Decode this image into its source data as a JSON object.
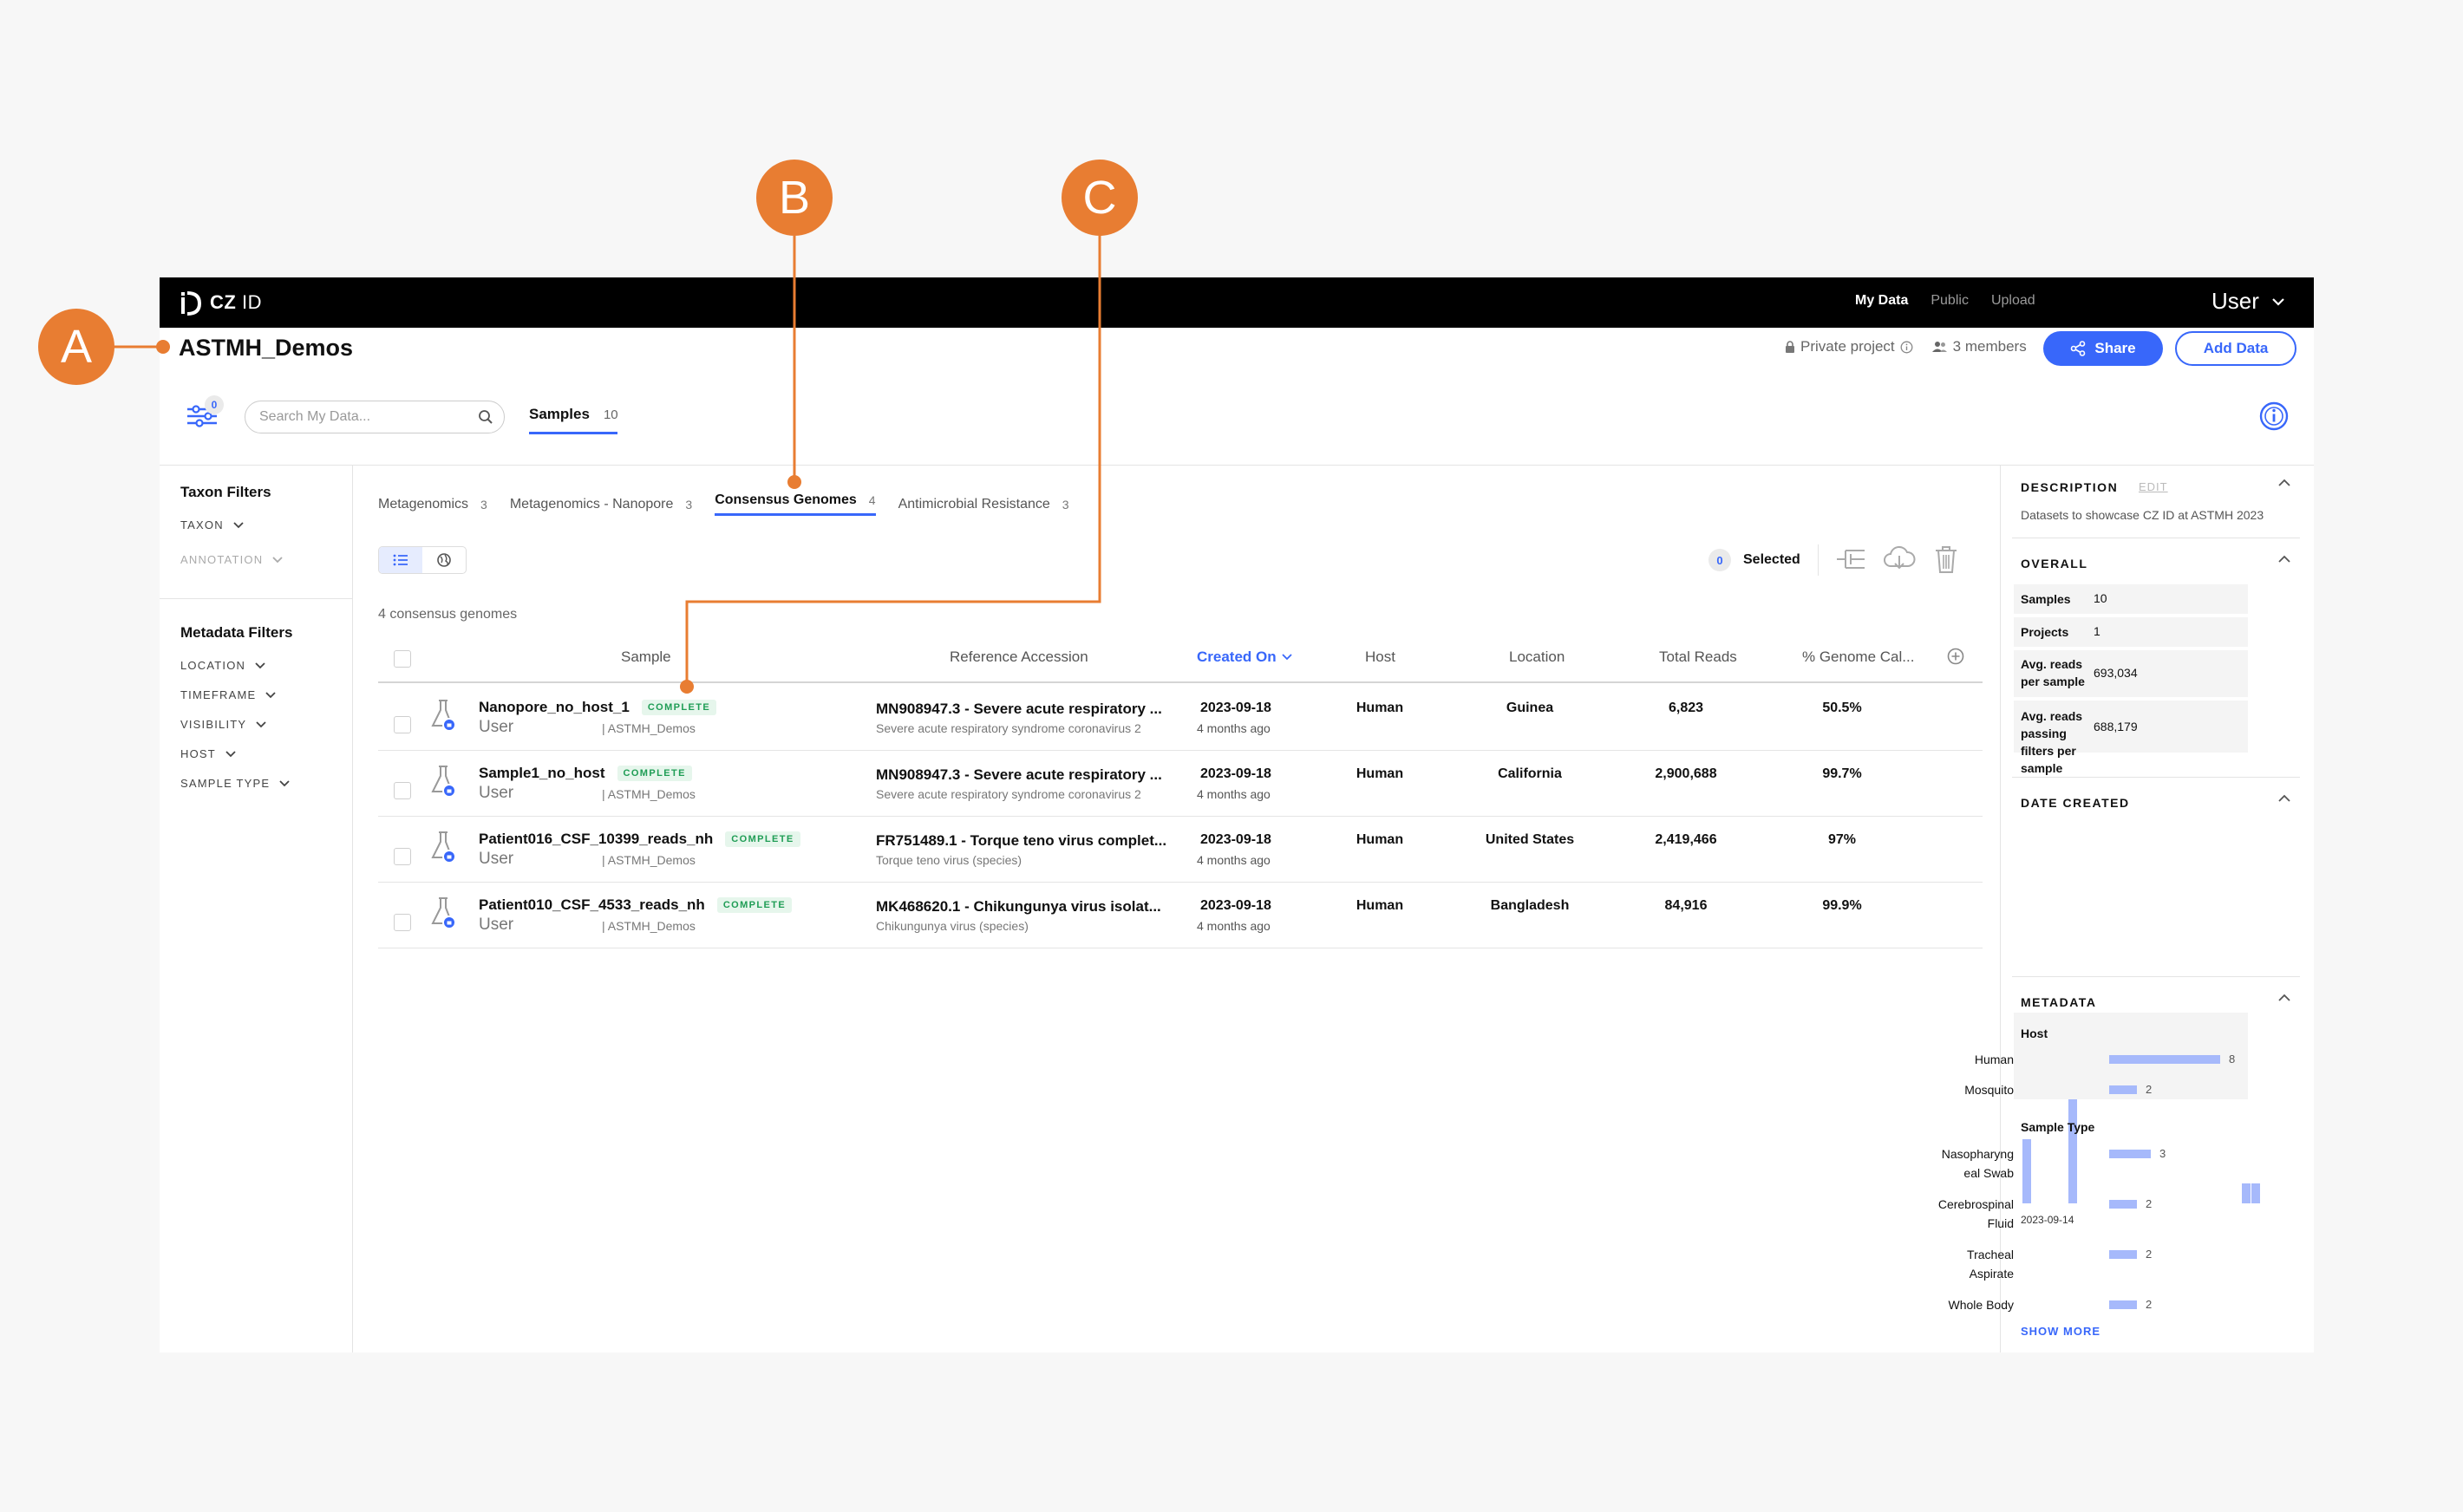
{
  "nav": {
    "logo_text_bold": "CZ",
    "logo_text": "ID",
    "links": [
      {
        "label": "My Data",
        "active": true
      },
      {
        "label": "Public",
        "active": false
      },
      {
        "label": "Upload",
        "active": false
      }
    ],
    "user": "User"
  },
  "project": {
    "title": "ASTMH_Demos",
    "privacy": "Private project",
    "members": "3 members",
    "share_label": "Share",
    "add_label": "Add Data"
  },
  "toolbar": {
    "filter_count": "0",
    "search_placeholder": "Search My Data...",
    "samples_tab": {
      "label": "Samples",
      "count": "10"
    }
  },
  "left_filters": {
    "taxon_title": "Taxon Filters",
    "taxon_items": [
      "Taxon",
      "Annotation"
    ],
    "metadata_title": "Metadata Filters",
    "metadata_items": [
      "Location",
      "Timeframe",
      "Visibility",
      "Host",
      "Sample Type"
    ]
  },
  "workflow_tabs": [
    {
      "label": "Metagenomics",
      "count": "3",
      "active": false
    },
    {
      "label": "Metagenomics - Nanopore",
      "count": "3",
      "active": false
    },
    {
      "label": "Consensus Genomes",
      "count": "4",
      "active": true
    },
    {
      "label": "Antimicrobial Resistance",
      "count": "3",
      "active": false
    }
  ],
  "selection": {
    "count": "0",
    "label": "Selected"
  },
  "summary": "4 consensus genomes",
  "table": {
    "headers": {
      "sample": "Sample",
      "reference": "Reference Accession",
      "created": "Created On",
      "host": "Host",
      "location": "Location",
      "total_reads": "Total Reads",
      "genome": "% Genome Cal..."
    },
    "rows": [
      {
        "name": "Nanopore_no_host_1",
        "status": "COMPLETE",
        "user": "User",
        "project": "| ASTMH_Demos",
        "accession": "MN908947.3 - Severe acute respiratory ...",
        "taxon": "Severe acute respiratory syndrome coronavirus 2",
        "date": "2023-09-18",
        "ago": "4 months ago",
        "host": "Human",
        "location": "Guinea",
        "reads": "6,823",
        "genome": "50.5%"
      },
      {
        "name": "Sample1_no_host",
        "status": "COMPLETE",
        "user": "User",
        "project": "| ASTMH_Demos",
        "accession": "MN908947.3 - Severe acute respiratory ...",
        "taxon": "Severe acute respiratory syndrome coronavirus 2",
        "date": "2023-09-18",
        "ago": "4 months ago",
        "host": "Human",
        "location": "California",
        "reads": "2,900,688",
        "genome": "99.7%"
      },
      {
        "name": "Patient016_CSF_10399_reads_nh",
        "status": "COMPLETE",
        "user": "User",
        "project": "| ASTMH_Demos",
        "accession": "FR751489.1 - Torque teno virus complet...",
        "taxon": "Torque teno virus (species)",
        "date": "2023-09-18",
        "ago": "4 months ago",
        "host": "Human",
        "location": "United States",
        "reads": "2,419,466",
        "genome": "97%"
      },
      {
        "name": "Patient010_CSF_4533_reads_nh",
        "status": "COMPLETE",
        "user": "User",
        "project": "| ASTMH_Demos",
        "accession": "MK468620.1 - Chikungunya virus isolat...",
        "taxon": "Chikungunya virus (species)",
        "date": "2023-09-18",
        "ago": "4 months ago",
        "host": "Human",
        "location": "Bangladesh",
        "reads": "84,916",
        "genome": "99.9%"
      }
    ]
  },
  "right_panel": {
    "description_title": "Description",
    "edit_label": "EDIT",
    "description": "Datasets to showcase CZ ID at ASTMH 2023",
    "overall_title": "Overall",
    "overall": [
      {
        "k": "Samples",
        "v": "10"
      },
      {
        "k": "Projects",
        "v": "1"
      },
      {
        "k": "Avg. reads per sample",
        "v": "693,034"
      },
      {
        "k": "Avg. reads passing filters per sample",
        "v": "688,179"
      }
    ],
    "date_title": "Date Created",
    "date_label": "2023-09-14",
    "date_hist": [
      0.58,
      0,
      0,
      0,
      0,
      1.0,
      0,
      0,
      0,
      0,
      0,
      0,
      0,
      0,
      0,
      0,
      0,
      0,
      0,
      0,
      0,
      0,
      0,
      0,
      0.18,
      0.18
    ],
    "metadata_title": "Metadata",
    "host_title": "Host",
    "host": [
      {
        "label": "Human",
        "value": 8
      },
      {
        "label": "Mosquito",
        "value": 2
      }
    ],
    "sample_type_title": "Sample Type",
    "sample_type": [
      {
        "label": [
          "Nasopharyng",
          "eal Swab"
        ],
        "value": 3
      },
      {
        "label": [
          "Cerebrospinal",
          "Fluid"
        ],
        "value": 2
      },
      {
        "label": [
          "Tracheal",
          "Aspirate"
        ],
        "value": 2
      },
      {
        "label": [
          "Whole Body"
        ],
        "value": 2
      }
    ],
    "show_more": "Show More"
  },
  "callouts": [
    "A",
    "B",
    "C"
  ],
  "colors": {
    "accent": "#3867fa",
    "callout": "#e87d32",
    "complete": "#1f9d55",
    "bar": "#a6b9fb"
  }
}
